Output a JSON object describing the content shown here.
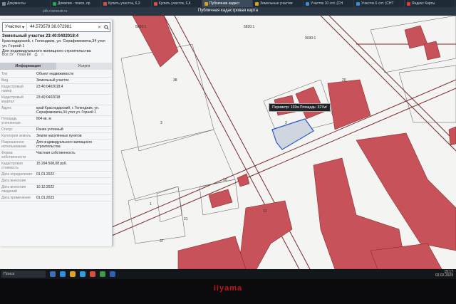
{
  "browser": {
    "tabs": [
      {
        "label": "Документы",
        "color": "#7a8aa0",
        "active": false
      },
      {
        "label": "Домклик - поиск, пр",
        "color": "#23a455",
        "active": false
      },
      {
        "label": "Купить участок, 6,3",
        "color": "#d94c4c",
        "active": false
      },
      {
        "label": "Купить участок, 6,4",
        "color": "#d94c4c",
        "active": false
      },
      {
        "label": "Публичная кадаст",
        "color": "#d6a419",
        "active": true
      },
      {
        "label": "Земельные участки",
        "color": "#d6a419",
        "active": false
      },
      {
        "label": "Участок 10 сот. (СН",
        "color": "#3d8ad6",
        "active": false
      },
      {
        "label": "Участок 6 сот. (СНТ",
        "color": "#3d8ad6",
        "active": false
      },
      {
        "label": "Яндекс Карты",
        "color": "#e23b3b",
        "active": false
      }
    ],
    "address": "pkk.rosreestr.ru",
    "page_title": "Публичная кадастровая карта"
  },
  "panel": {
    "search_category": "Участки",
    "search_query": "44.573578 38.072981",
    "object_title": "Земельный участок 23:40:0402018:4",
    "object_address": "Краснодарский, г. Геленджик, ул. Серафимовича,34 угол ул. Горной 1",
    "object_use": "Для индивидуального жилищного строительства",
    "tools": [
      "Все ЗУ",
      "План КК"
    ],
    "tab_info": "Информация",
    "tab_services": "Услуги",
    "rows": [
      {
        "key": "Тип",
        "value": "Объект недвижимости"
      },
      {
        "key": "Вид",
        "value": "Земельный участок"
      },
      {
        "key": "Кадастровый номер",
        "value": "23:40:0402018:4"
      },
      {
        "key": "Кадастровый квартал",
        "value": "23:40:0402018"
      },
      {
        "key": "Адрес",
        "value": "край Краснодарский, г. Геленджик, ул. Серафимовича,34 угол ул. Горной 1"
      },
      {
        "key": "Площадь уточненная",
        "value": "804 кв. м"
      },
      {
        "key": "Статус",
        "value": "Ранее учтенный"
      },
      {
        "key": "Категория земель",
        "value": "Земли населённых пунктов"
      },
      {
        "key": "Разрешенное использование",
        "value": "Для индивидуального жилищного строительства"
      },
      {
        "key": "Форма собственности",
        "value": "Частная собственность"
      },
      {
        "key": "Кадастровая стоимость",
        "value": "15 294 508,08 руб."
      },
      {
        "key": "Дата определения",
        "value": "01.01.2022"
      },
      {
        "key": "Дата внесения",
        "value": ""
      },
      {
        "key": "Дата внесения сведений",
        "value": "10.12.2022"
      },
      {
        "key": "Дата применения",
        "value": "01.01.2023"
      }
    ]
  },
  "map": {
    "tooltip": "Периметр: 102м Площадь: 327м²",
    "plot_labels": [
      "3",
      "38",
      "20",
      "3",
      "21",
      "10",
      "37",
      "1",
      "12"
    ],
    "block_labels": [
      "5830:1",
      "5830:1",
      "9030:1"
    ],
    "colors": {
      "building": "#c8525a",
      "line": "#8a2a2a",
      "selected": "#cfd6df"
    }
  },
  "taskbar": {
    "search": "Поиск",
    "time": "15:17",
    "date": "02.02.2023"
  },
  "monitor_brand": "iiyama"
}
